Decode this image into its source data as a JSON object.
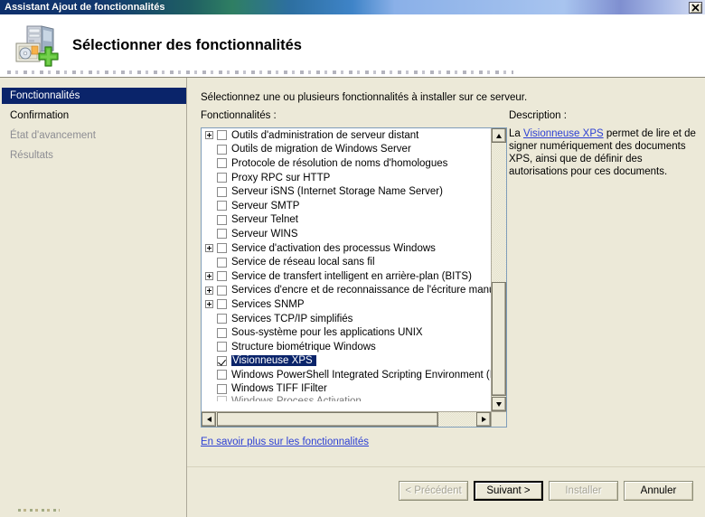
{
  "window": {
    "title": "Assistant Ajout de fonctionnalités",
    "close_label": "✕"
  },
  "banner": {
    "heading": "Sélectionner des fonctionnalités",
    "icon": "server-add-icon"
  },
  "sidebar": {
    "items": [
      {
        "label": "Fonctionnalités",
        "state": "selected"
      },
      {
        "label": "Confirmation",
        "state": "normal"
      },
      {
        "label": "État d'avancement",
        "state": "disabled"
      },
      {
        "label": "Résultats",
        "state": "disabled"
      }
    ]
  },
  "main": {
    "intro": "Sélectionnez une ou plusieurs fonctionnalités à installer sur ce serveur.",
    "list_label": "Fonctionnalités :",
    "description_label": "Description :",
    "learn_more": "En savoir plus sur les fonctionnalités",
    "description": {
      "prefix": "La ",
      "link": "Visionneuse XPS",
      "suffix": " permet de lire et de signer numériquement des documents XPS, ainsi que de définir des autorisations pour ces documents."
    }
  },
  "features": [
    {
      "label": "Outils d'administration de serveur distant",
      "expander": "plus",
      "checked": false,
      "selected": false
    },
    {
      "label": "Outils de migration de Windows Server",
      "expander": "none",
      "checked": false,
      "selected": false
    },
    {
      "label": "Protocole de résolution de noms d'homologues",
      "expander": "none",
      "checked": false,
      "selected": false
    },
    {
      "label": "Proxy RPC sur HTTP",
      "expander": "none",
      "checked": false,
      "selected": false
    },
    {
      "label": "Serveur iSNS (Internet Storage Name Server)",
      "expander": "none",
      "checked": false,
      "selected": false
    },
    {
      "label": "Serveur SMTP",
      "expander": "none",
      "checked": false,
      "selected": false
    },
    {
      "label": "Serveur Telnet",
      "expander": "none",
      "checked": false,
      "selected": false
    },
    {
      "label": "Serveur WINS",
      "expander": "none",
      "checked": false,
      "selected": false
    },
    {
      "label": "Service d'activation des processus Windows",
      "expander": "plus",
      "checked": false,
      "selected": false
    },
    {
      "label": "Service de réseau local sans fil",
      "expander": "none",
      "checked": false,
      "selected": false
    },
    {
      "label": "Service de transfert intelligent en arrière-plan (BITS)",
      "expander": "plus",
      "checked": false,
      "selected": false
    },
    {
      "label": "Services d'encre et de reconnaissance de l'écriture manuscrite",
      "expander": "plus",
      "checked": false,
      "selected": false
    },
    {
      "label": "Services SNMP",
      "expander": "plus",
      "checked": false,
      "selected": false
    },
    {
      "label": "Services TCP/IP simplifiés",
      "expander": "none",
      "checked": false,
      "selected": false
    },
    {
      "label": "Sous-système pour les applications UNIX",
      "expander": "none",
      "checked": false,
      "selected": false
    },
    {
      "label": "Structure biométrique Windows",
      "expander": "none",
      "checked": false,
      "selected": false
    },
    {
      "label": "Visionneuse XPS",
      "expander": "none",
      "checked": true,
      "selected": true
    },
    {
      "label": "Windows PowerShell Integrated Scripting Environment (ISE)",
      "expander": "none",
      "checked": false,
      "selected": false
    },
    {
      "label": "Windows TIFF IFilter",
      "expander": "none",
      "checked": false,
      "selected": false
    },
    {
      "label": "Windows Process Activation",
      "expander": "none",
      "checked": false,
      "selected": false,
      "partial": true
    }
  ],
  "buttons": [
    {
      "label": "< Précédent",
      "state": "disabled",
      "name": "back-button"
    },
    {
      "label": "Suivant >",
      "state": "default",
      "name": "next-button"
    },
    {
      "label": "Installer",
      "state": "disabled",
      "name": "install-button"
    },
    {
      "label": "Annuler",
      "state": "enabled",
      "name": "cancel-button"
    }
  ],
  "colors": {
    "titlebar_start": "#0d2f6b",
    "selection": "#0a246a",
    "window_face": "#ece9d8",
    "link": "#2c3fd4",
    "disabled_text": "#a6a496"
  }
}
